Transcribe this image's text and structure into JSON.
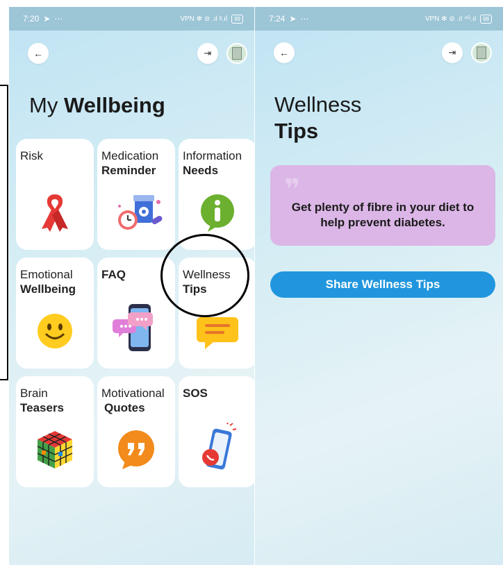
{
  "left_screen": {
    "status_time": "7:20",
    "status_icons": "⋯",
    "status_right": "VPN ✻ ⊘ .ıl ᵍ.ıl",
    "battery": "99",
    "title_light": "My",
    "title_bold": "Wellbeing",
    "tiles": [
      {
        "line1": "Risk",
        "line2": "",
        "icon": "ribbon-icon"
      },
      {
        "line1": "Medication",
        "line2": "Reminder",
        "icon": "pills-clock-icon"
      },
      {
        "line1": "Information",
        "line2": "Needs",
        "icon": "info-bubble-icon"
      },
      {
        "line1": "Emotional",
        "line2": "Wellbeing",
        "icon": "smiley-icon"
      },
      {
        "line1": "",
        "line2": "FAQ",
        "icon": "phone-chat-icon"
      },
      {
        "line1": "Wellness",
        "line2": "Tips",
        "icon": "chat-bubble-icon"
      },
      {
        "line1": "Brain",
        "line2": "Teasers",
        "icon": "rubiks-cube-icon"
      },
      {
        "line1": "Motivational",
        "line2": "Quotes",
        "icon": "quote-bubble-icon"
      },
      {
        "line1": "",
        "line2": "SOS",
        "icon": "sos-phone-icon"
      }
    ]
  },
  "right_screen": {
    "status_time": "7:24",
    "status_icons": "⋯",
    "status_right": "VPN ✻ ⊘ .ıl ⁴ᴳ.ıl",
    "battery": "98",
    "title_light": "Wellness",
    "title_bold": "Tips",
    "tip_text": "Get plenty of fibre in your diet to help prevent diabetes.",
    "share_label": "Share Wellness Tips"
  },
  "colors": {
    "background_gradient": "#cfe9f3",
    "tip_card": "#dbb6e6",
    "share_button": "#2196de",
    "status_bar": "#9cc5d6"
  }
}
